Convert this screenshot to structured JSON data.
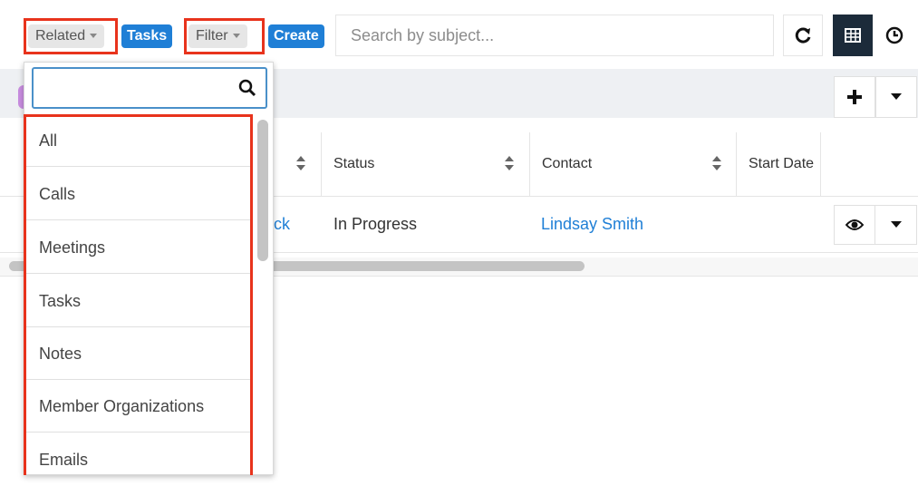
{
  "toolbar": {
    "related_label": "Related",
    "tasks_label": "Tasks",
    "filter_label": "Filter",
    "create_label": "Create",
    "search_placeholder": "Search by subject..."
  },
  "table": {
    "columns": [
      "Status",
      "Contact",
      "Start Date"
    ],
    "row": {
      "subject_partial": "ck",
      "status": "In Progress",
      "contact": "Lindsay Smith"
    }
  },
  "dropdown": {
    "search_value": "",
    "items": [
      "All",
      "Calls",
      "Meetings",
      "Tasks",
      "Notes",
      "Member Organizations",
      "Emails"
    ]
  },
  "colors": {
    "accent": "#1f7fd6",
    "highlight": "#e8331c",
    "dark_button": "#1c2b3a"
  },
  "icons": [
    "refresh-icon",
    "grid-view-icon",
    "clock-icon",
    "plus-icon",
    "caret-down-icon",
    "eye-icon",
    "search-icon"
  ]
}
